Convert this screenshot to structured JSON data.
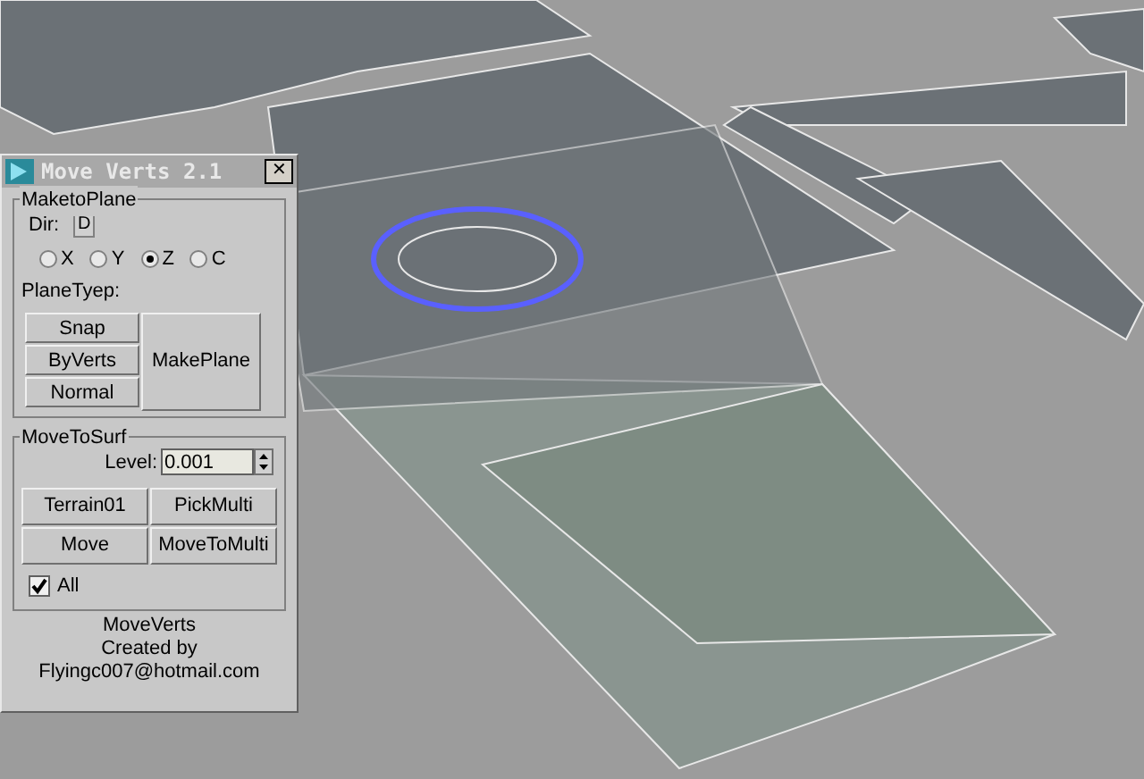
{
  "window": {
    "title": "Move Verts 2.1",
    "close": "✕"
  },
  "make_to_plane": {
    "title": "MaketoPlane",
    "dir_label": "Dir:",
    "dir_button": "D",
    "axes": [
      {
        "label": "X",
        "selected": false
      },
      {
        "label": "Y",
        "selected": false
      },
      {
        "label": "Z",
        "selected": true
      },
      {
        "label": "C",
        "selected": false
      }
    ],
    "plane_type_label": "PlaneTyep:",
    "type_buttons": [
      "Snap",
      "ByVerts",
      "Normal"
    ],
    "make_button": "MakePlane"
  },
  "move_to_surf": {
    "title": "MoveToSurf",
    "level_label": "Level:",
    "level_value": "0.001",
    "buttons": [
      "Terrain01",
      "PickMulti",
      "Move",
      "MoveToMulti"
    ],
    "all": {
      "label": "All",
      "checked": true
    }
  },
  "footer": [
    "MoveVerts",
    "Created by",
    "Flyingc007@hotmail.com"
  ]
}
